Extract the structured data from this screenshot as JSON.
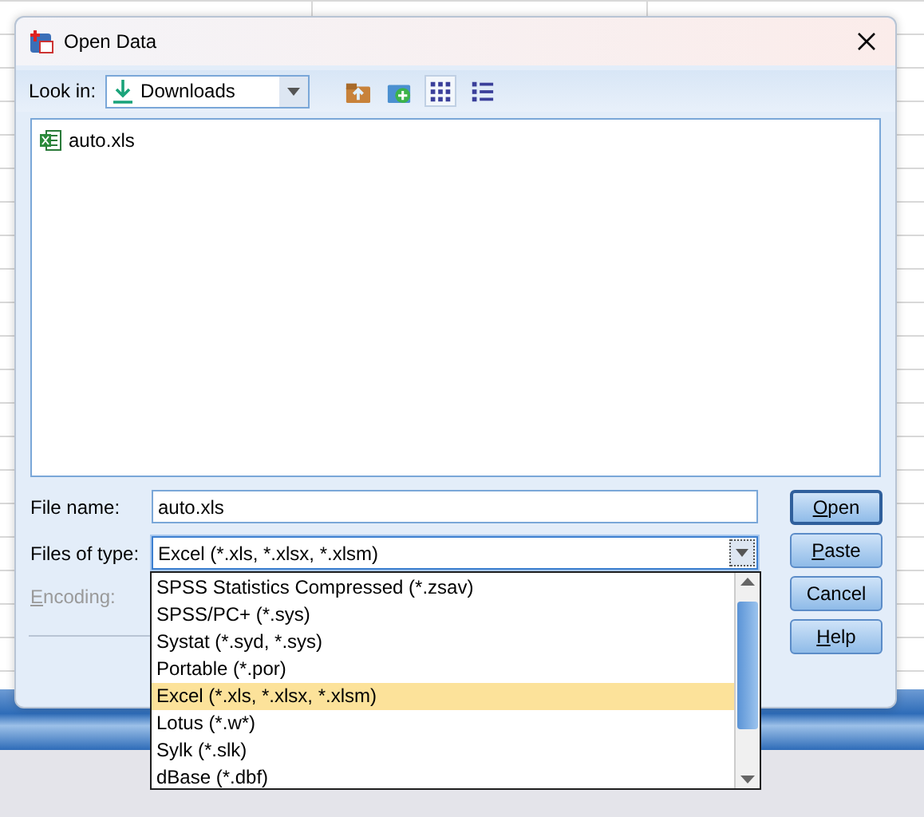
{
  "window": {
    "title": "Open Data"
  },
  "look_in": {
    "label": "Look in:",
    "value": "Downloads"
  },
  "toolbar": [
    {
      "kind": "up",
      "selected": false
    },
    {
      "kind": "newfolder",
      "selected": false
    },
    {
      "kind": "list",
      "selected": true
    },
    {
      "kind": "details",
      "selected": false
    }
  ],
  "files": [
    {
      "name": "auto.xls",
      "kind": "excel"
    }
  ],
  "file_name": {
    "label": "File name:",
    "value": "auto.xls"
  },
  "files_of_type": {
    "label": "Files of type:",
    "value": "Excel (*.xls, *.xlsx, *.xlsm)",
    "expanded": true,
    "options": [
      {
        "label": "SPSS Statistics Compressed (*.zsav)",
        "selected": false
      },
      {
        "label": "SPSS/PC+ (*.sys)",
        "selected": false
      },
      {
        "label": "Systat (*.syd, *.sys)",
        "selected": false
      },
      {
        "label": "Portable (*.por)",
        "selected": false
      },
      {
        "label": "Excel (*.xls, *.xlsx, *.xlsm)",
        "selected": true
      },
      {
        "label": "Lotus (*.w*)",
        "selected": false
      },
      {
        "label": "Sylk (*.slk)",
        "selected": false
      },
      {
        "label": "dBase (*.dbf)",
        "selected": false
      }
    ]
  },
  "encoding": {
    "key": "E",
    "rest": "ncoding:",
    "disabled": true
  },
  "buttons": [
    {
      "key": "O",
      "rest": "pen",
      "default": true
    },
    {
      "key": "P",
      "rest": "aste",
      "default": false
    },
    {
      "rest": "Cancel",
      "default": false
    },
    {
      "key": "H",
      "rest": "elp",
      "default": false
    }
  ]
}
